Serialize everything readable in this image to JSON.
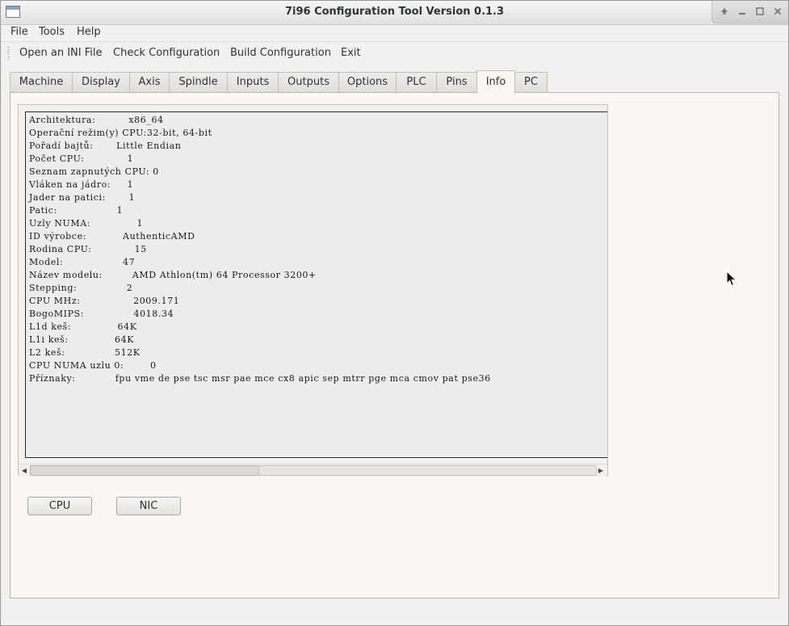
{
  "window": {
    "title": "7i96 Configuration Tool Version 0.1.3",
    "controls": [
      "up-arrow-icon",
      "minimize-icon",
      "maximize-icon",
      "close-icon"
    ]
  },
  "menubar": {
    "items": [
      "File",
      "Tools",
      "Help"
    ]
  },
  "toolbar": {
    "items": [
      "Open an INI File",
      "Check Configuration",
      "Build Configuration",
      "Exit"
    ]
  },
  "tabs": {
    "items": [
      "Machine",
      "Display",
      "Axis",
      "Spindle",
      "Inputs",
      "Outputs",
      "Options",
      "PLC",
      "Pins",
      "Info",
      "PC"
    ],
    "active": "Info"
  },
  "info": {
    "lines": [
      "Architektura:          x86_64",
      "Operační režim(y) CPU:32-bit, 64-bit",
      "Pořadí bajtů:       Little Endian",
      "Počet CPU:             1",
      "Seznam zapnutých CPU: 0",
      "Vláken na jádro:     1",
      "Jader na patici:       1",
      "Patic:                  1",
      "Uzly NUMA:              1",
      "ID výrobce:           AuthenticAMD",
      "Rodina CPU:             15",
      "Model:                  47",
      "Název modelu:         AMD Athlon(tm) 64 Processor 3200+",
      "Stepping:               2",
      "CPU MHz:                2009.171",
      "BogoMIPS:               4018.34",
      "L1d keš:              64K",
      "L1i keš:              64K",
      "L2 keš:               512K",
      "CPU NUMA uzlu 0:        0",
      "Příznaky:            fpu vme de pse tsc msr pae mce cx8 apic sep mtrr pge mca cmov pat pse36"
    ]
  },
  "buttons": {
    "cpu": "CPU",
    "nic": "NIC"
  }
}
